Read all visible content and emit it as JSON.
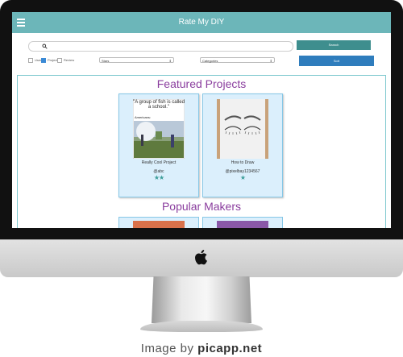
{
  "app": {
    "title": "Rate My DIY"
  },
  "search": {
    "placeholder": "",
    "button_label": "Search"
  },
  "filters": {
    "options": [
      {
        "label": "User",
        "checked": false
      },
      {
        "label": "Project",
        "checked": true
      },
      {
        "label": "Review",
        "checked": false
      }
    ],
    "sort_select": "Stars",
    "category_select": "Categories",
    "sort_button_label": "Sort"
  },
  "featured": {
    "title": "Featured Projects",
    "cards": [
      {
        "name": "Really Cool Project",
        "user": "@abc",
        "stars": "★★",
        "meme_text": "\"A group of fish is called a school.\"",
        "meme_caption": "Americans:"
      },
      {
        "name": "How to Draw",
        "user": "@pixelbay1234567",
        "stars": "★"
      }
    ]
  },
  "makers": {
    "title": "Popular Makers"
  },
  "credit": {
    "prefix": "Image by",
    "site": "picapp.net"
  },
  "colors": {
    "appbar": "#6cb6b9",
    "search_button": "#3e8e8e",
    "sort_button": "#2f7dbd",
    "heading": "#8a3d9e",
    "card_bg": "#dbeffc",
    "star": "#3e9e9a"
  }
}
